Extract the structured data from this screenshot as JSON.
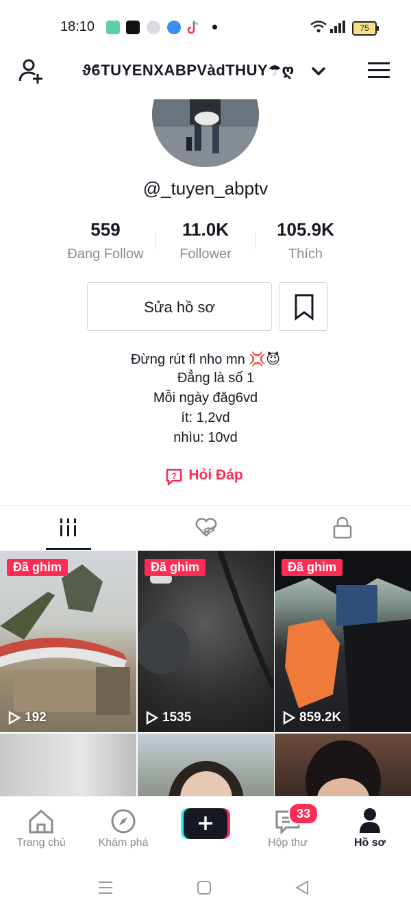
{
  "status_bar": {
    "time": "18:10",
    "battery": "75",
    "icons": [
      "calendar-app-icon",
      "play-together-icon",
      "game-icon",
      "messenger-icon",
      "tiktok-icon",
      "dot-icon",
      "wifi-icon",
      "signal-icon",
      "battery-icon"
    ]
  },
  "header": {
    "title": "ϑϐTUYENXABPVàdTHUY☂ღ",
    "left_icon": "add-user-icon",
    "right_icon": "menu-icon",
    "dropdown_icon": "chevron-down-icon"
  },
  "profile": {
    "username": "@_tuyen_abptv",
    "stats": [
      {
        "value": "559",
        "label": "Đang Follow"
      },
      {
        "value": "11.0K",
        "label": "Follower"
      },
      {
        "value": "105.9K",
        "label": "Thích"
      }
    ],
    "edit_label": "Sửa hồ sơ",
    "bio": [
      "Đừng rút fl nho mn 💢😈",
      "Đẳng là số 1",
      "Mỗi ngày đăg6vd",
      "ít: 1,2vd",
      "nhìu: 10vd"
    ],
    "qa_label": "Hỏi Đáp"
  },
  "tabs": [
    "videos-grid-icon",
    "liked-hidden-icon",
    "private-lock-icon"
  ],
  "videos": [
    {
      "pinned": "Đã ghim",
      "views": "192"
    },
    {
      "pinned": "Đã ghim",
      "views": "1535"
    },
    {
      "pinned": "Đã ghim",
      "views": "859.2K"
    },
    {
      "pinned": "",
      "views": ""
    },
    {
      "pinned": "",
      "views": ""
    },
    {
      "pinned": "",
      "views": ""
    }
  ],
  "bottom_nav": {
    "home": "Trang chủ",
    "explore": "Khám phá",
    "inbox": "Hộp thư",
    "inbox_badge": "33",
    "profile": "Hồ sơ"
  }
}
